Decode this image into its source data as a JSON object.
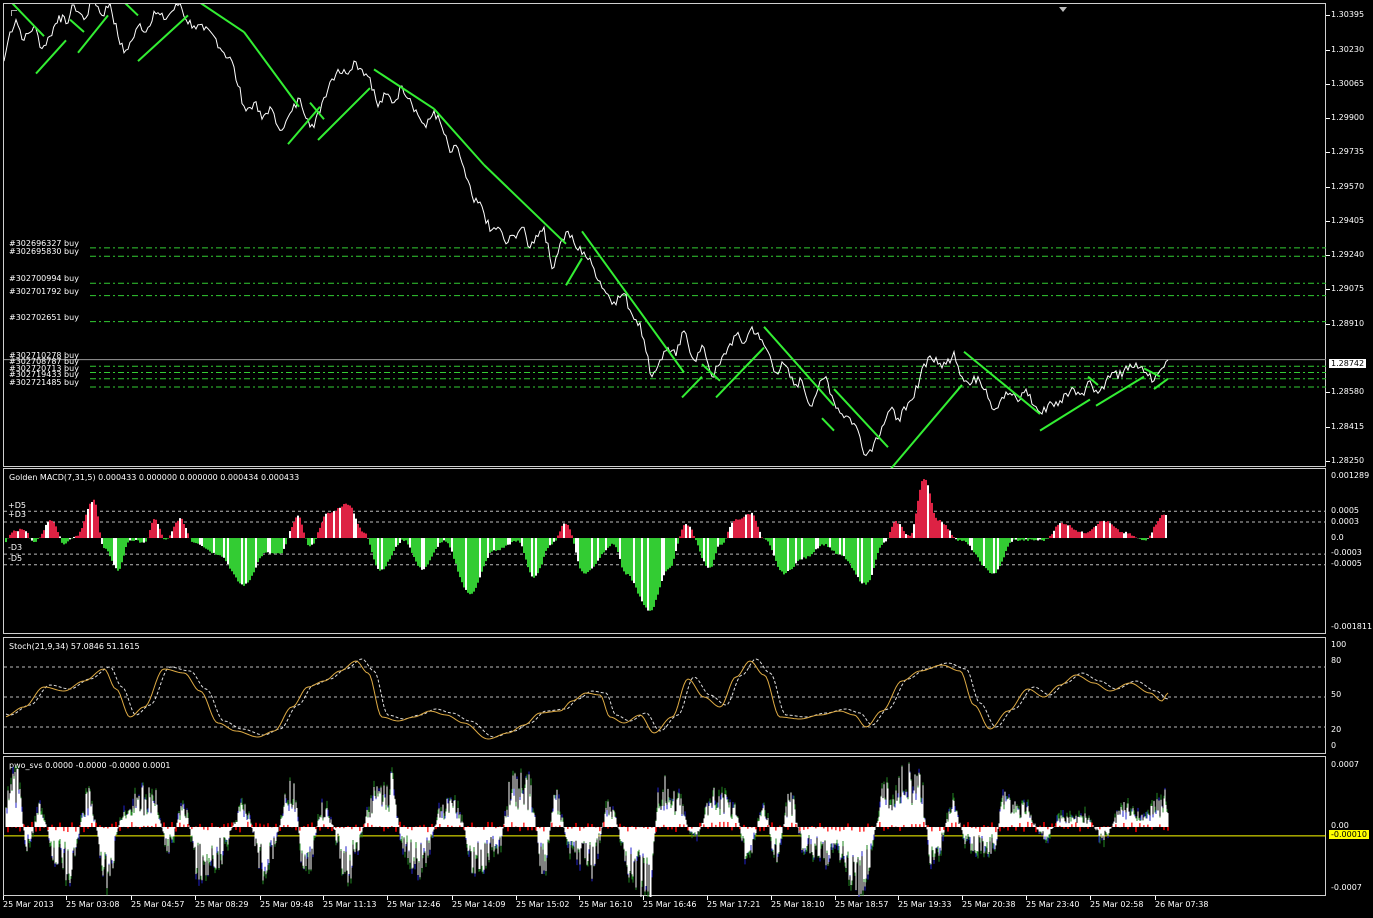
{
  "colors": {
    "background": "#000000",
    "price_line": "#ffffff",
    "trend": "#33ee33",
    "order_line": "#33cc33",
    "macd_up": "#dd2244",
    "macd_down": "#33cc33",
    "stoch_main": "#ddaa44",
    "pwo_pos": "#ffffff",
    "pwo_red": "#ff0000",
    "pwo_green": "#228822",
    "pwo_blue": "#2222cc",
    "zero_line": "#ffff00"
  },
  "main": {
    "current_price": "1.28742",
    "price_ticks": [
      "1.30395",
      "1.30230",
      "1.30065",
      "1.29900",
      "1.29735",
      "1.29570",
      "1.29405",
      "1.29240",
      "1.29075",
      "1.28910",
      "1.28580",
      "1.28415",
      "1.28250"
    ],
    "orders": [
      {
        "label": "#302696327 buy",
        "price": 1.2928
      },
      {
        "label": "#302695830 buy",
        "price": 1.2924
      },
      {
        "label": "#302700994 buy",
        "price": 1.2911
      },
      {
        "label": "#302701792 buy",
        "price": 1.2905
      },
      {
        "label": "#302702651 buy",
        "price": 1.28925
      },
      {
        "label": "#302710278 buy",
        "price": 1.28742
      },
      {
        "label": "#302708787 buy",
        "price": 1.2871
      },
      {
        "label": "#302720713 buy",
        "price": 1.2868
      },
      {
        "label": "#302719433 buy",
        "price": 1.2865
      },
      {
        "label": "#302721485 buy",
        "price": 1.2861
      }
    ]
  },
  "macd": {
    "title": "Golden MACD(7,31,5) 0.000433 0.000000 0.000000 0.000434 0.000433",
    "ticks": [
      "0.001289",
      "0.0005",
      "0.0003",
      "0.0",
      "-0.0003",
      "-0.0005",
      "-0.001811"
    ],
    "left_labels": [
      "+D5",
      "+D3",
      "-D3",
      "-D5"
    ]
  },
  "stoch": {
    "title": "Stoch(21,9,34) 57.0846 51.1615",
    "ticks": [
      "100",
      "80",
      "50",
      "20",
      "0"
    ]
  },
  "pwo": {
    "title": "pwo_svs 0.0000 -0.0000 -0.0000 0.0001",
    "ticks": [
      "0.0007",
      "0.00",
      "-0.0007"
    ],
    "current": "-0.00010"
  },
  "time_labels": [
    "25 Mar 2013",
    "25 Mar 03:08",
    "25 Mar 04:57",
    "25 Mar 08:29",
    "25 Mar 09:48",
    "25 Mar 11:13",
    "25 Mar 12:46",
    "25 Mar 14:09",
    "25 Mar 15:02",
    "25 Mar 16:10",
    "25 Mar 16:46",
    "25 Mar 17:21",
    "25 Mar 18:10",
    "25 Mar 18:57",
    "25 Mar 19:33",
    "25 Mar 20:38",
    "25 Mar 23:40",
    "25 Mar 02:58",
    "26 Mar 07:38"
  ],
  "chart_data": {
    "type": "line",
    "price_series_key": [
      [
        0,
        1.3018
      ],
      [
        6,
        1.3032
      ],
      [
        12,
        1.3038
      ],
      [
        20,
        1.3028
      ],
      [
        30,
        1.3035
      ],
      [
        38,
        1.3024
      ],
      [
        46,
        1.303
      ],
      [
        55,
        1.304
      ],
      [
        62,
        1.3036
      ],
      [
        70,
        1.3045
      ],
      [
        80,
        1.3038
      ],
      [
        90,
        1.3048
      ],
      [
        98,
        1.304
      ],
      [
        106,
        1.3046
      ],
      [
        114,
        1.303
      ],
      [
        120,
        1.3022
      ],
      [
        128,
        1.3028
      ],
      [
        136,
        1.3036
      ],
      [
        142,
        1.3032
      ],
      [
        150,
        1.3042
      ],
      [
        160,
        1.3038
      ],
      [
        168,
        1.3042
      ],
      [
        176,
        1.3046
      ],
      [
        182,
        1.3038
      ],
      [
        190,
        1.3035
      ],
      [
        200,
        1.3033
      ],
      [
        210,
        1.303
      ],
      [
        220,
        1.3022
      ],
      [
        228,
        1.3018
      ],
      [
        234,
        1.3006
      ],
      [
        242,
        1.2994
      ],
      [
        250,
        1.2998
      ],
      [
        258,
        1.299
      ],
      [
        266,
        1.2996
      ],
      [
        272,
        1.2988
      ],
      [
        280,
        1.2986
      ],
      [
        288,
        1.2994
      ],
      [
        296,
        1.3
      ],
      [
        304,
        1.299
      ],
      [
        310,
        1.2986
      ],
      [
        318,
        1.2998
      ],
      [
        326,
        1.3008
      ],
      [
        334,
        1.3014
      ],
      [
        342,
        1.3012
      ],
      [
        350,
        1.3018
      ],
      [
        358,
        1.3014
      ],
      [
        366,
        1.301
      ],
      [
        374,
        1.2996
      ],
      [
        382,
        1.3002
      ],
      [
        390,
        1.2998
      ],
      [
        398,
        1.3006
      ],
      [
        406,
        1.3
      ],
      [
        414,
        1.2992
      ],
      [
        422,
        1.2986
      ],
      [
        430,
        1.2994
      ],
      [
        438,
        1.2986
      ],
      [
        446,
        1.2974
      ],
      [
        454,
        1.2976
      ],
      [
        462,
        1.2962
      ],
      [
        470,
        1.295
      ],
      [
        478,
        1.2948
      ],
      [
        486,
        1.2936
      ],
      [
        494,
        1.2938
      ],
      [
        502,
        1.293
      ],
      [
        510,
        1.2934
      ],
      [
        518,
        1.2938
      ],
      [
        526,
        1.2928
      ],
      [
        532,
        1.2934
      ],
      [
        540,
        1.2938
      ],
      [
        548,
        1.2918
      ],
      [
        556,
        1.293
      ],
      [
        564,
        1.2936
      ],
      [
        572,
        1.2928
      ],
      [
        580,
        1.2926
      ],
      [
        590,
        1.2918
      ],
      [
        600,
        1.2908
      ],
      [
        610,
        1.2902
      ],
      [
        620,
        1.2906
      ],
      [
        628,
        1.2896
      ],
      [
        636,
        1.2892
      ],
      [
        642,
        1.2878
      ],
      [
        648,
        1.2866
      ],
      [
        656,
        1.2874
      ],
      [
        664,
        1.288
      ],
      [
        672,
        1.2876
      ],
      [
        680,
        1.2888
      ],
      [
        690,
        1.2874
      ],
      [
        700,
        1.288
      ],
      [
        708,
        1.2866
      ],
      [
        716,
        1.2872
      ],
      [
        724,
        1.288
      ],
      [
        732,
        1.2886
      ],
      [
        740,
        1.2882
      ],
      [
        748,
        1.289
      ],
      [
        756,
        1.2884
      ],
      [
        764,
        1.2878
      ],
      [
        772,
        1.2868
      ],
      [
        780,
        1.2872
      ],
      [
        790,
        1.2862
      ],
      [
        798,
        1.2864
      ],
      [
        806,
        1.2852
      ],
      [
        814,
        1.286
      ],
      [
        822,
        1.2866
      ],
      [
        830,
        1.2854
      ],
      [
        838,
        1.2848
      ],
      [
        846,
        1.2846
      ],
      [
        854,
        1.284
      ],
      [
        862,
        1.2828
      ],
      [
        870,
        1.2834
      ],
      [
        878,
        1.2842
      ],
      [
        886,
        1.285
      ],
      [
        894,
        1.2846
      ],
      [
        902,
        1.285
      ],
      [
        910,
        1.2856
      ],
      [
        918,
        1.287
      ],
      [
        926,
        1.2876
      ],
      [
        934,
        1.2872
      ],
      [
        942,
        1.2872
      ],
      [
        950,
        1.2878
      ],
      [
        958,
        1.2866
      ],
      [
        966,
        1.2862
      ],
      [
        974,
        1.2866
      ],
      [
        982,
        1.286
      ],
      [
        990,
        1.285
      ],
      [
        998,
        1.2856
      ],
      [
        1006,
        1.2858
      ],
      [
        1014,
        1.2854
      ],
      [
        1022,
        1.286
      ],
      [
        1030,
        1.2852
      ],
      [
        1038,
        1.2848
      ],
      [
        1046,
        1.2854
      ],
      [
        1054,
        1.2852
      ],
      [
        1062,
        1.2858
      ],
      [
        1070,
        1.286
      ],
      [
        1078,
        1.2858
      ],
      [
        1086,
        1.2864
      ],
      [
        1094,
        1.2858
      ],
      [
        1102,
        1.2864
      ],
      [
        1110,
        1.2868
      ],
      [
        1118,
        1.2866
      ],
      [
        1126,
        1.2872
      ],
      [
        1134,
        1.287
      ],
      [
        1142,
        1.2868
      ],
      [
        1150,
        1.2864
      ],
      [
        1158,
        1.287
      ],
      [
        1164,
        1.2874
      ]
    ]
  }
}
